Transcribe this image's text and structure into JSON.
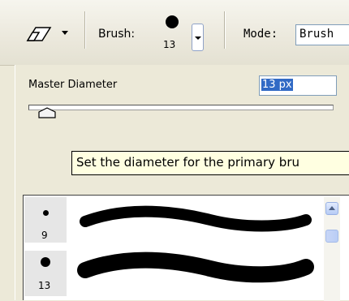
{
  "toolbar": {
    "tool_icon": "eraser-icon",
    "brush_label": "Brush:",
    "brush_size": "13",
    "mode_label": "Mode:",
    "mode_value": "Brush"
  },
  "panel": {
    "master_diameter_label": "Master Diameter",
    "diameter_value": "13 px",
    "tooltip": "Set the diameter for the primary bru"
  },
  "brush_list": [
    {
      "size": "9"
    },
    {
      "size": "13"
    }
  ],
  "colors": {
    "panel_bg": "#ece9d8",
    "tooltip_bg": "#ffffe1",
    "selection": "#316ac5"
  }
}
